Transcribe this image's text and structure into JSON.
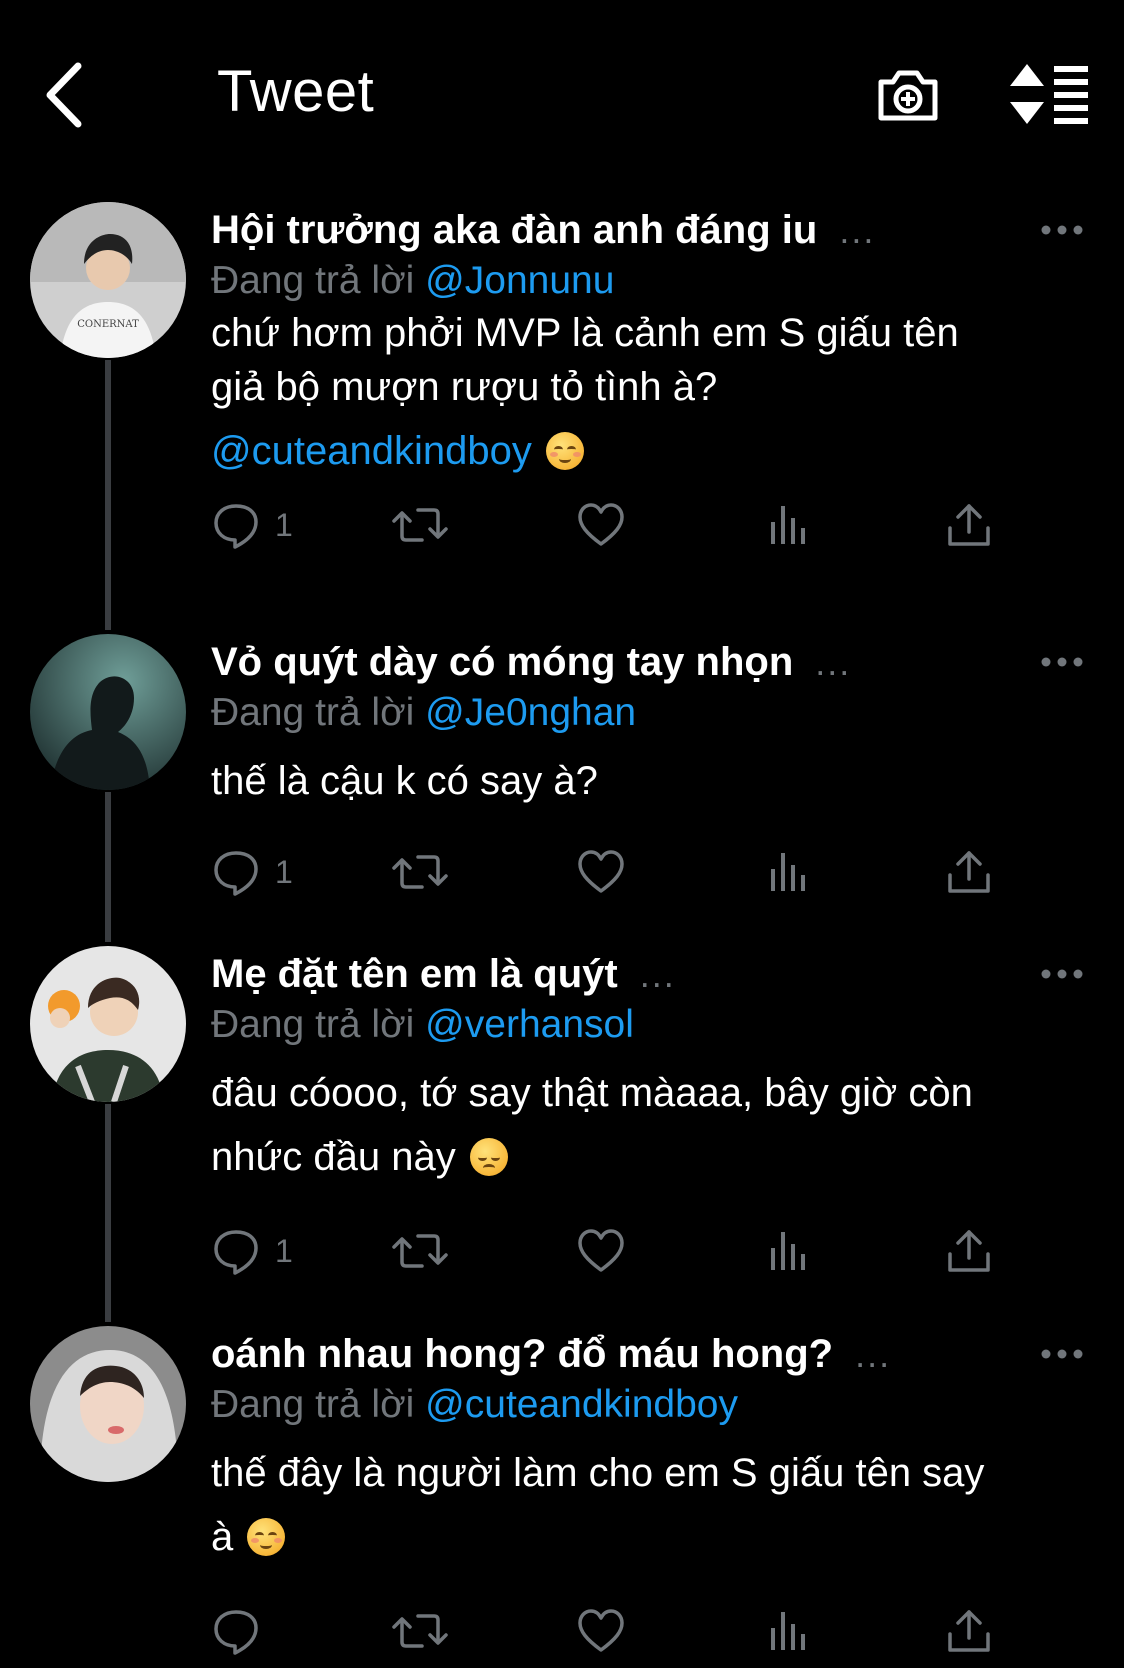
{
  "header": {
    "title": "Tweet"
  },
  "colors": {
    "background": "#000000",
    "accent": "#1d9bf0",
    "muted": "#71767b",
    "thread_line": "#3a3d41"
  },
  "reply_prefix": "Đang trả lời",
  "tweets": [
    {
      "name": "Hội trưởng aka đàn anh đáng iu",
      "ellipsis": "...",
      "reply_to": "@Jonnunu",
      "lines": [
        "chứ hơm phởi MVP là cảnh em S giấu tên",
        "giả bộ mượn rượu tỏ tình à?"
      ],
      "mention_line": "@cuteandkindboy",
      "emoji": "smiling-face-icon",
      "reply_count": "1"
    },
    {
      "name": "Vỏ quýt dày có móng tay nhọn",
      "ellipsis": "...",
      "reply_to": "@Je0nghan",
      "lines": [
        "thế là cậu k có say à?"
      ],
      "reply_count": "1"
    },
    {
      "name": "Mẹ đặt tên em là quýt",
      "ellipsis": "...",
      "reply_to": "@verhansol",
      "lines": [
        "đâu cóooo, tớ say thật màaaa, bây giờ còn",
        "nhức đầu này"
      ],
      "emoji": "pensive-face-icon",
      "reply_count": "1"
    },
    {
      "name": "oánh nhau hong? đổ máu hong?",
      "ellipsis": "...",
      "reply_to": "@cuteandkindboy",
      "lines": [
        "thế đây là người làm cho em S giấu tên say",
        "à"
      ],
      "emoji": "smiling-face-icon",
      "reply_count": ""
    }
  ]
}
